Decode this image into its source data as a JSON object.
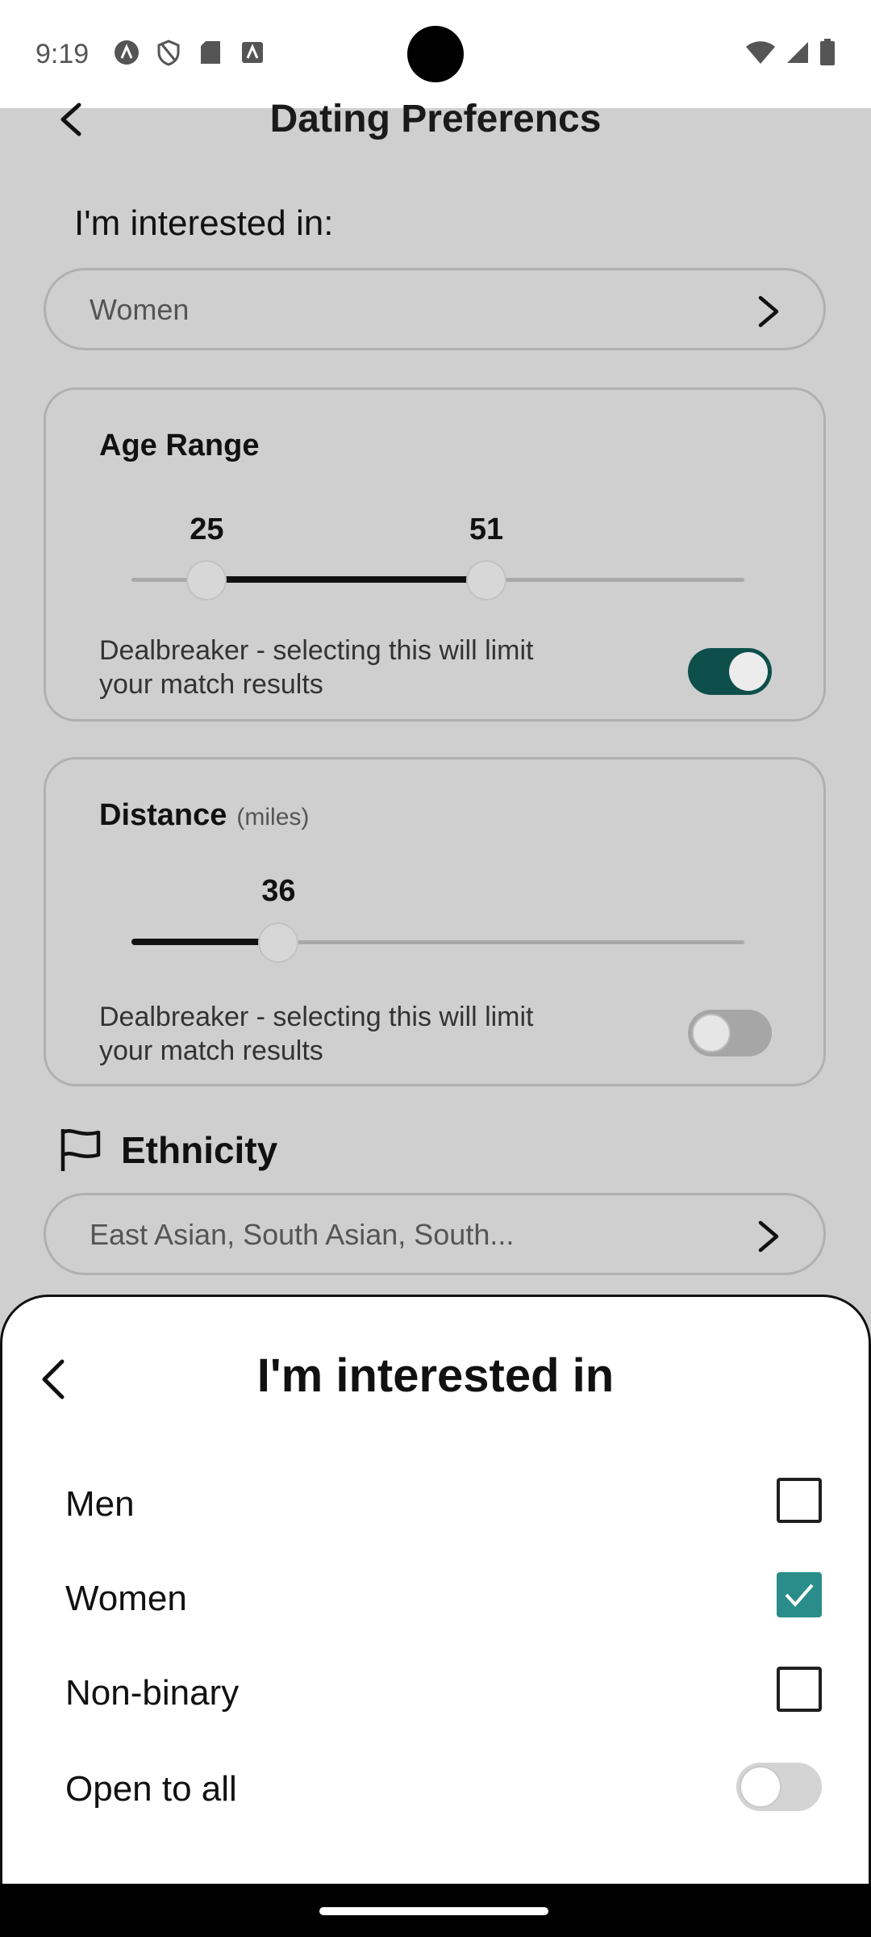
{
  "status_bar": {
    "time": "9:19",
    "left_icons": [
      "assistant-icon",
      "shield-icon",
      "sd-card-icon",
      "a-square-icon"
    ],
    "right_icons": [
      "wifi-icon",
      "signal-icon",
      "battery-icon"
    ]
  },
  "header": {
    "title": "Dating Preferencs",
    "back_icon": "chevron-left-icon"
  },
  "interested_in": {
    "label": "I'm interested in:",
    "value": "Women"
  },
  "age_range": {
    "title": "Age Range",
    "min": 25,
    "max": 51,
    "min_label": "25",
    "max_label": "51",
    "dealbreaker_text": "Dealbreaker - selecting this will limit your match results",
    "dealbreaker_on": true
  },
  "distance": {
    "title": "Distance",
    "unit": "(miles)",
    "value": 36,
    "value_label": "36",
    "dealbreaker_text": "Dealbreaker - selecting this will limit your match results",
    "dealbreaker_on": false
  },
  "ethnicity": {
    "label": "Ethnicity",
    "icon": "flag-icon",
    "value": "East Asian, South Asian, South..."
  },
  "sheet": {
    "title": "I'm interested in",
    "options": [
      {
        "label": "Men",
        "checked": false
      },
      {
        "label": "Women",
        "checked": true
      },
      {
        "label": "Non-binary",
        "checked": false
      }
    ],
    "open_to_all": {
      "label": "Open to all",
      "on": false
    }
  },
  "colors": {
    "accent_dark_teal": "#0e4f4b",
    "checkbox_teal": "#2a8d8a",
    "background_gray": "#cfcfcf"
  }
}
